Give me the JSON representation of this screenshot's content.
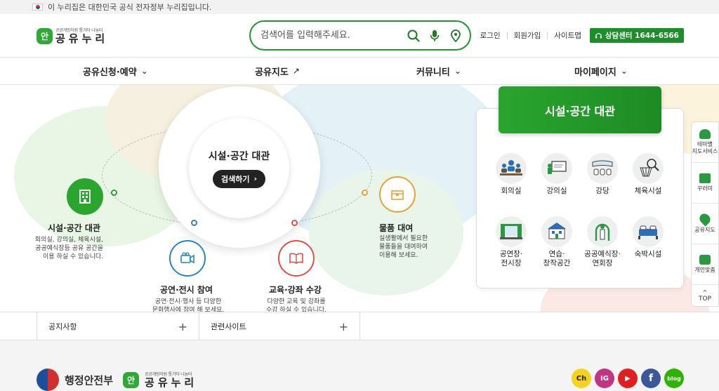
{
  "topbar": {
    "notice": "이 누리집은 대한민국 공식 전자정부 누리집입니다."
  },
  "logo": {
    "badge": "안",
    "subtitle": "공공개방자원 통기타 나눔터",
    "name": "공유누리"
  },
  "search": {
    "placeholder": "검색어를 입력해주세요."
  },
  "util": {
    "login": "로그인",
    "signup": "회원가입",
    "sitemap": "사이트맵",
    "callcenter": "상담센터 1644-6566"
  },
  "gnb": [
    {
      "label": "공유신청·예약",
      "arrow": "⌄"
    },
    {
      "label": "공유지도",
      "arrow": "↗"
    },
    {
      "label": "커뮤니티",
      "arrow": "⌄"
    },
    {
      "label": "마이페이지",
      "arrow": "⌄"
    }
  ],
  "center": {
    "title": "시설·공간 대관",
    "button": "검색하기"
  },
  "features": [
    {
      "title": "시설·공간 대관",
      "desc": [
        "회의실, 강의실, 체육시설,",
        "공공예식장등 공유 공간을",
        "이용 하실 수 있습니다."
      ],
      "color": "#2aa52e",
      "icon": "building-icon"
    },
    {
      "title": "공연·전시 참여",
      "desc": [
        "공연·전시·행사 등 다양한",
        "문화행사에 참여 해 보세요."
      ],
      "color": "#2a84c7",
      "icon": "camera-icon"
    },
    {
      "title": "교육·강좌 수강",
      "desc": [
        "다양한 교육 및 강좌를",
        "수강 하실 수 있습니다."
      ],
      "color": "#e0504a",
      "icon": "book-icon"
    },
    {
      "title": "물품 대여",
      "desc": [
        "실생활에서 필요한",
        "물품들을 대여하여",
        "이용해 보세요."
      ],
      "color": "#f0a030",
      "icon": "box-icon"
    }
  ],
  "panel": {
    "title": "시설·공간 대관",
    "facilities": [
      {
        "label": "회의실",
        "icon": "meeting-room-icon"
      },
      {
        "label": "강의실",
        "icon": "lecture-room-icon"
      },
      {
        "label": "강당",
        "icon": "auditorium-icon"
      },
      {
        "label": "체육시설",
        "icon": "sports-facility-icon"
      },
      {
        "label": "공연장·\n전시장",
        "icon": "stage-icon"
      },
      {
        "label": "연습·\n창작공간",
        "icon": "practice-space-icon"
      },
      {
        "label": "공공예식장·\n연회장",
        "icon": "wedding-hall-icon"
      },
      {
        "label": "숙박시설",
        "icon": "lodging-icon"
      }
    ]
  },
  "quickmenu": [
    {
      "label": "테마별\n지도서비스",
      "icon": "theme-map-icon"
    },
    {
      "label": "꾸러미",
      "icon": "package-icon"
    },
    {
      "label": "공유지도",
      "icon": "map-icon"
    },
    {
      "label": "개인맞춤",
      "icon": "personal-icon"
    }
  ],
  "top_label": "TOP",
  "footer_links": [
    {
      "label": "공지사항"
    },
    {
      "label": "관련사이트"
    }
  ],
  "footer": {
    "ministry": "행정안전부",
    "logo_name": "공유누리",
    "logo_sub": "공공개방자원 통기타 나눔터"
  },
  "social": [
    {
      "label": "Ch",
      "color": "#f7d21c",
      "text_color": "#222"
    },
    {
      "label": "IG",
      "color": "#c13584",
      "text_color": "#fff"
    },
    {
      "label": "▶",
      "color": "#e02020",
      "text_color": "#fff"
    },
    {
      "label": "f",
      "color": "#3b5998",
      "text_color": "#fff"
    },
    {
      "label": "blog",
      "color": "#2db400",
      "text_color": "#fff"
    }
  ]
}
